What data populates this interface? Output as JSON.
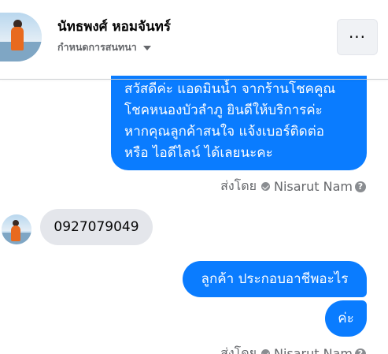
{
  "header": {
    "contact_name": "นัทธพงศ์ หอมจันทร์",
    "subtitle": "กำหนดการสนทนา",
    "more_label": "···"
  },
  "messages": {
    "outgoing_1": [
      "สวัสดีค่ะ แอดมินน้ำ จากร้านโชคคูณ",
      "โชคหนองบัวลำภู ยินดีให้บริการค่ะ",
      "หากคุณลูกค้าสนใจ แจ้งเบอร์ติดต่อ",
      "หรือ ไอดีไลน์ ได้เลยนะคะ"
    ],
    "incoming_1": "0927079049",
    "outgoing_2": "ลูกค้า ประกอบอาชีพอะไร",
    "outgoing_3": "ค่ะ"
  },
  "sent_by": {
    "label": "ส่งโดย",
    "sender": "Nisarut Nam",
    "help": "?"
  },
  "colors": {
    "outgoing_bubble": "#0a7cff",
    "incoming_bubble": "#e4e6eb",
    "secondary_text": "#65676b"
  },
  "icons": [
    "verified-check-icon",
    "help-icon",
    "caret-down-icon",
    "more-options-icon"
  ]
}
